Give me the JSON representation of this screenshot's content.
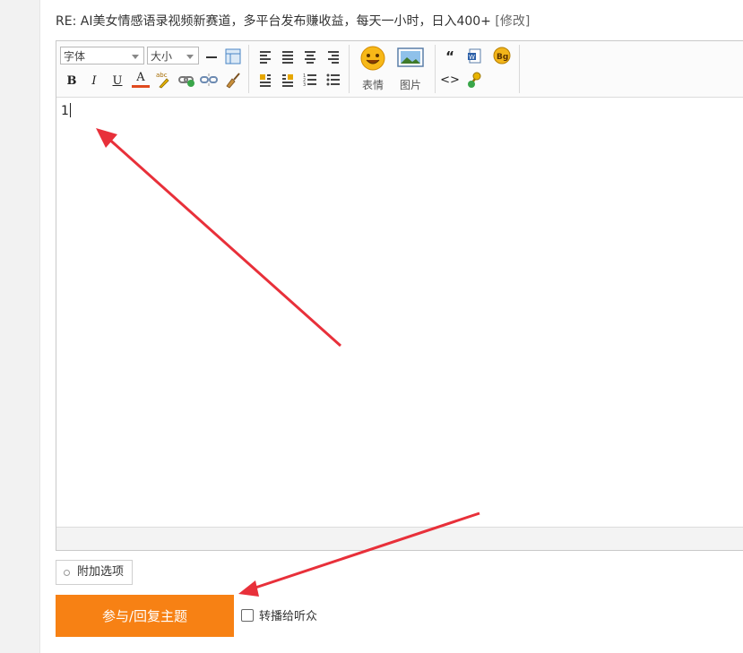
{
  "thread": {
    "title": "RE: AI美女情感语录视频新赛道，多平台发布赚收益，每天一小时，日入400+",
    "edit_link": "[修改]"
  },
  "toolbar": {
    "font_select": "字体",
    "size_select": "大小",
    "bold": "B",
    "italic": "I",
    "underline": "U",
    "font_color": "A",
    "emoji_label": "表情",
    "image_label": "图片",
    "quote": "“",
    "code": "<>"
  },
  "editor": {
    "content": "1"
  },
  "attach_options_label": "附加选项",
  "submit_label": "参与/回复主题",
  "relay_label": "转播给听众",
  "colors": {
    "submit_bg": "#f78114",
    "annotation_arrow": "#e8303a"
  }
}
